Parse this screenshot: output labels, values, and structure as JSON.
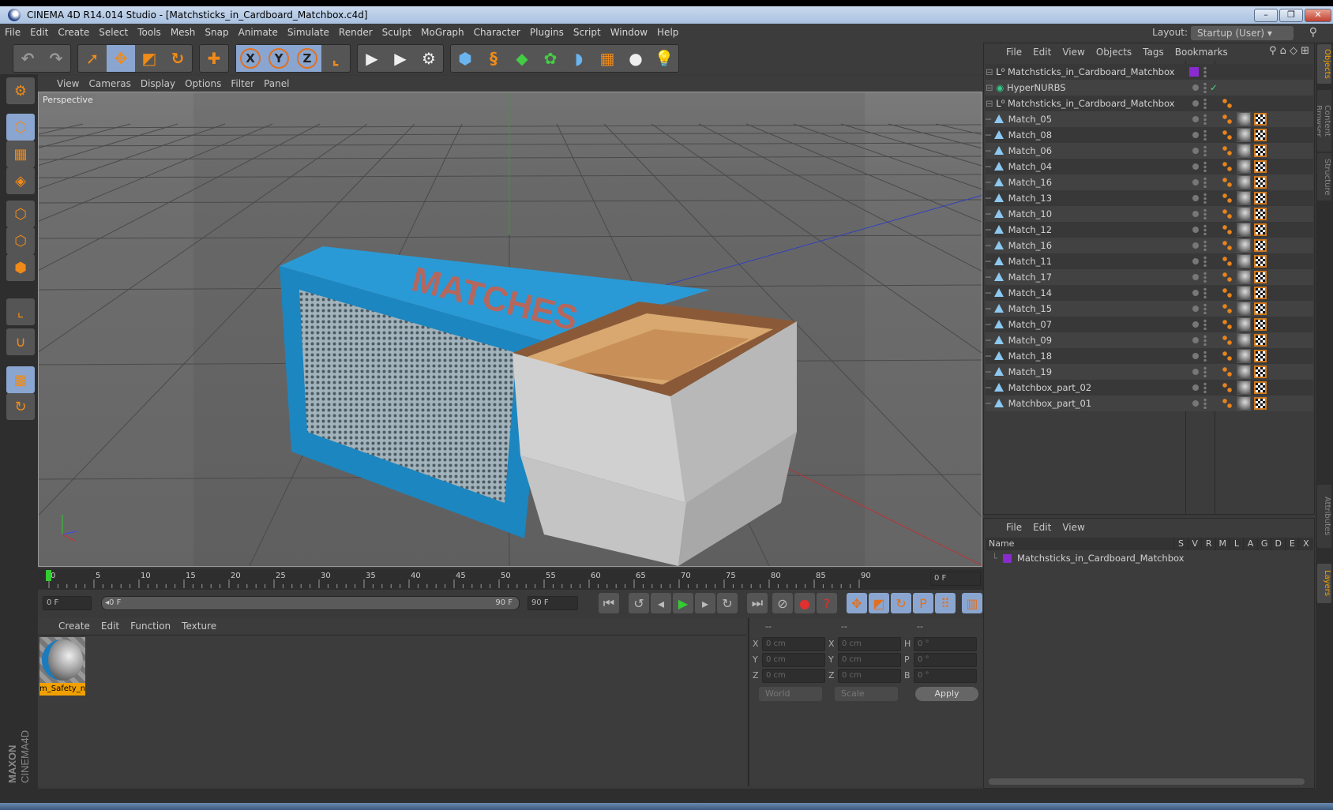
{
  "window": {
    "title": "CINEMA 4D R14.014 Studio - [Matchsticks_in_Cardboard_Matchbox.c4d]"
  },
  "menubar": [
    "File",
    "Edit",
    "Create",
    "Select",
    "Tools",
    "Mesh",
    "Snap",
    "Animate",
    "Simulate",
    "Render",
    "Sculpt",
    "MoGraph",
    "Character",
    "Plugins",
    "Script",
    "Window",
    "Help"
  ],
  "layout": {
    "label": "Layout:",
    "value": "Startup (User)"
  },
  "toolbar": {
    "groups": [
      [
        "undo-icon",
        "redo-icon"
      ],
      [
        "live-selection-icon",
        "move-icon",
        "scale-icon",
        "rotate-icon"
      ],
      [
        "add-object-icon"
      ],
      [
        "x-axis-icon",
        "y-axis-icon",
        "z-axis-icon",
        "coordinate-system-icon"
      ],
      [
        "render-view-icon",
        "render-picture-viewer-icon",
        "render-settings-icon"
      ],
      [
        "cube-icon",
        "spline-icon",
        "nurbs-icon",
        "array-icon",
        "deformer-icon",
        "floor-icon",
        "camera-icon",
        "light-icon"
      ]
    ],
    "glyphs": {
      "undo-icon": "↶",
      "redo-icon": "↷",
      "live-selection-icon": "➚",
      "move-icon": "✥",
      "scale-icon": "◩",
      "rotate-icon": "↻",
      "add-object-icon": "✚",
      "x-axis-icon": "X",
      "y-axis-icon": "Y",
      "z-axis-icon": "Z",
      "coordinate-system-icon": "⌞",
      "render-view-icon": "▶",
      "render-picture-viewer-icon": "▶",
      "render-settings-icon": "⚙",
      "cube-icon": "⬢",
      "spline-icon": "§",
      "nurbs-icon": "◆",
      "array-icon": "✿",
      "deformer-icon": "◗",
      "floor-icon": "▦",
      "camera-icon": "●",
      "light-icon": "💡"
    }
  },
  "left_toolbar": [
    "make-editable-icon",
    "model-mode-icon",
    "texture-mode-icon",
    "workplane-mode-icon",
    "points-mode-icon",
    "edges-mode-icon",
    "polygons-mode-icon",
    "axis-mode-icon",
    "snap-icon",
    "workplane-lock-icon",
    "workplane-rotate-icon"
  ],
  "viewport": {
    "menu": [
      "View",
      "Cameras",
      "Display",
      "Options",
      "Filter",
      "Panel"
    ],
    "camera_label": "Perspective"
  },
  "timeline": {
    "ticks": [
      0,
      5,
      10,
      15,
      20,
      25,
      30,
      35,
      40,
      45,
      50,
      55,
      60,
      65,
      70,
      75,
      80,
      85,
      90
    ],
    "current_frame": "0 F",
    "start": "0 F",
    "range_start": "0 F",
    "range_end": "90 F",
    "end": "90 F"
  },
  "materials": {
    "menu": [
      "Create",
      "Edit",
      "Function",
      "Texture"
    ],
    "items": [
      {
        "name": "m_Safety_n"
      }
    ]
  },
  "coordinates": {
    "headers": [
      "--",
      "--",
      "--"
    ],
    "rows": [
      {
        "a": "X",
        "av": "0 cm",
        "b": "X",
        "bv": "0 cm",
        "c": "H",
        "cv": "0 °"
      },
      {
        "a": "Y",
        "av": "0 cm",
        "b": "Y",
        "bv": "0 cm",
        "c": "P",
        "cv": "0 °"
      },
      {
        "a": "Z",
        "av": "0 cm",
        "b": "Z",
        "bv": "0 cm",
        "c": "B",
        "cv": "0 °"
      }
    ],
    "space": "World",
    "mode": "Scale",
    "apply": "Apply"
  },
  "objects": {
    "menu": [
      "File",
      "Edit",
      "View",
      "Objects",
      "Tags",
      "Bookmarks"
    ],
    "root": "Matchsticks_in_Cardboard_Matchbox",
    "hypernurbs": "HyperNURBS",
    "group": "Matchsticks_in_Cardboard_Matchbox",
    "children": [
      "Match_05",
      "Match_08",
      "Match_06",
      "Match_04",
      "Match_16",
      "Match_13",
      "Match_10",
      "Match_12",
      "Match_16",
      "Match_11",
      "Match_17",
      "Match_14",
      "Match_15",
      "Match_07",
      "Match_09",
      "Match_18",
      "Match_19",
      "Matchbox_part_02",
      "Matchbox_part_01"
    ],
    "layer_color": "#8a2bd0"
  },
  "layers": {
    "menu": [
      "File",
      "Edit",
      "View"
    ],
    "header_name": "Name",
    "columns": [
      "S",
      "V",
      "R",
      "M",
      "L",
      "A",
      "G",
      "D",
      "E",
      "X"
    ],
    "rows": [
      {
        "name": "Matchsticks_in_Cardboard_Matchbox",
        "color": "#8a2bd0"
      }
    ]
  },
  "side_tabs": [
    "Objects",
    "Content Browser",
    "Structure",
    "Attributes",
    "Layers"
  ],
  "brand": {
    "logo": "MAXON CINEMA 4D"
  },
  "colors": {
    "accent": "#f08a18",
    "selected": "#8aa6d0",
    "box_blue": "#1c8cc8"
  }
}
